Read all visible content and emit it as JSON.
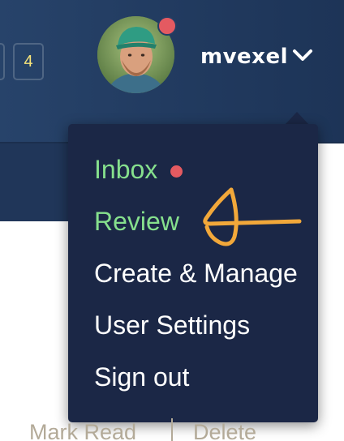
{
  "header": {
    "counters": [
      "",
      "4"
    ],
    "username": "mvexel"
  },
  "user_menu": {
    "items": [
      {
        "label": "Inbox",
        "has_notification": true,
        "highlighted": true
      },
      {
        "label": "Review",
        "highlighted": true
      },
      {
        "label": "Create & Manage"
      },
      {
        "label": "User Settings"
      },
      {
        "label": "Sign out"
      }
    ]
  },
  "notifications": {
    "actions": [
      "Mark Read",
      "Delete"
    ]
  },
  "colors": {
    "navbar": "#213a5f",
    "menu_bg": "#1b2746",
    "highlight_green": "#86e08d",
    "notification_red": "#e45a61",
    "counter_yellow": "#f6e37a",
    "annotation_orange": "#f2a83a"
  }
}
